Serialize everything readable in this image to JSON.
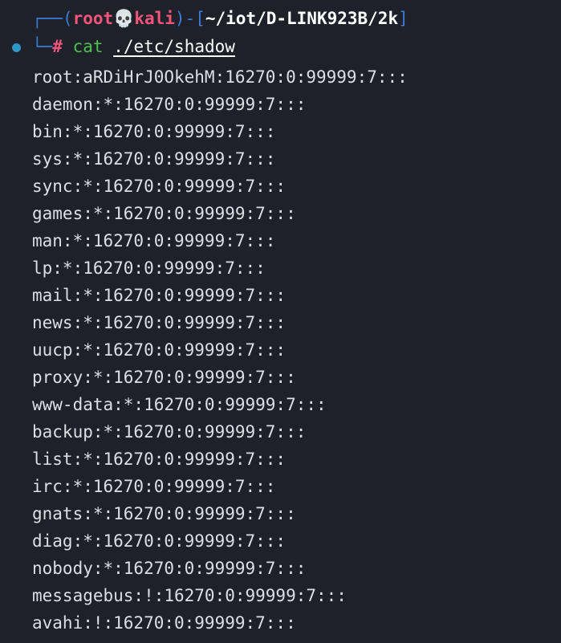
{
  "prompt": {
    "corner_top": "┌──",
    "open_paren": "(",
    "user": "root",
    "skull": "💀",
    "host": "kali",
    "close_paren": ")",
    "dash": "-",
    "open_bracket": "[",
    "cwd": "~/iot/D-LINK923B/2k",
    "close_bracket": "]",
    "corner_bottom": "└─",
    "symbol": "#",
    "command": "cat",
    "argument": "./etc/shadow"
  },
  "output_lines": [
    "root:aRDiHrJ0OkehM:16270:0:99999:7:::",
    "daemon:*:16270:0:99999:7:::",
    "bin:*:16270:0:99999:7:::",
    "sys:*:16270:0:99999:7:::",
    "sync:*:16270:0:99999:7:::",
    "games:*:16270:0:99999:7:::",
    "man:*:16270:0:99999:7:::",
    "lp:*:16270:0:99999:7:::",
    "mail:*:16270:0:99999:7:::",
    "news:*:16270:0:99999:7:::",
    "uucp:*:16270:0:99999:7:::",
    "proxy:*:16270:0:99999:7:::",
    "www-data:*:16270:0:99999:7:::",
    "backup:*:16270:0:99999:7:::",
    "list:*:16270:0:99999:7:::",
    "irc:*:16270:0:99999:7:::",
    "gnats:*:16270:0:99999:7:::",
    "diag:*:16270:0:99999:7:::",
    "nobody:*:16270:0:99999:7:::",
    "messagebus:!:16270:0:99999:7:::",
    "avahi:!:16270:0:99999:7:::"
  ],
  "colors": {
    "background": "#1e2129",
    "prompt_frame": "#3a7bd5",
    "user_host": "#f2557a",
    "command": "#4ec04e",
    "status_dot": "#2f96c8"
  }
}
